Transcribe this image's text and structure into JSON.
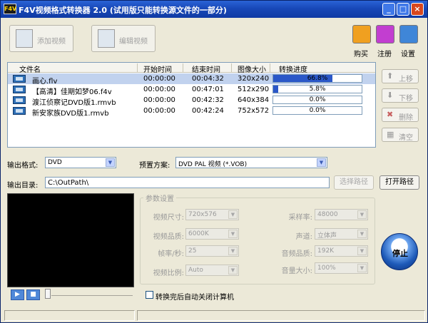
{
  "window": {
    "title": "F4V视频格式转换器 2.0 (试用版只能转换源文件的一部分)",
    "icon_text": "F4V",
    "controls": {
      "minimize": "_",
      "maximize": "□",
      "close": "×"
    }
  },
  "toolbar": {
    "add_video": "添加视频",
    "edit_video": "编辑视频",
    "buy": "购买",
    "register": "注册",
    "settings": "设置"
  },
  "file_list": {
    "headers": {
      "name": "文件名",
      "start": "开始时间",
      "end": "结束时间",
      "size": "图像大小",
      "progress": "转换进度"
    },
    "rows": [
      {
        "name": "画心.flv",
        "start": "00:00:00",
        "end": "00:04:32",
        "size": "320x240",
        "progress": 66.8,
        "progress_label": "66.8%",
        "selected": true
      },
      {
        "name": "【高清】佳期如梦06.f4v",
        "start": "00:00:00",
        "end": "00:47:01",
        "size": "512x290",
        "progress": 5.8,
        "progress_label": "5.8%",
        "selected": false
      },
      {
        "name": "渡江侦察记DVD版1.rmvb",
        "start": "00:00:00",
        "end": "00:42:32",
        "size": "640x384",
        "progress": 0,
        "progress_label": "0.0%",
        "selected": false
      },
      {
        "name": "新安家族DVD版1.rmvb",
        "start": "00:00:00",
        "end": "00:42:24",
        "size": "752x572",
        "progress": 0,
        "progress_label": "0.0%",
        "selected": false
      }
    ]
  },
  "side_buttons": {
    "move_up": {
      "label": "上移",
      "icon": "⬆"
    },
    "move_down": {
      "label": "下移",
      "icon": "⬇"
    },
    "delete": {
      "label": "删除",
      "icon": "✖"
    },
    "clear": {
      "label": "清空",
      "icon": "▦"
    }
  },
  "output": {
    "format_label": "输出格式:",
    "format_value": "DVD",
    "preset_label": "预置方案:",
    "preset_value": "DVD PAL 视频  (*.VOB)",
    "dir_label": "输出目录:",
    "dir_value": "C:\\OutPath\\",
    "choose_path": "选择路径",
    "open_path": "打开路径"
  },
  "params": {
    "group_title": "参数设置",
    "video_size": {
      "label": "视频尺寸:",
      "value": "720x576"
    },
    "video_quality": {
      "label": "视频品质:",
      "value": "6000K"
    },
    "fps": {
      "label": "帧率/秒:",
      "value": "25"
    },
    "aspect": {
      "label": "视频比例:",
      "value": "Auto"
    },
    "sample_rate": {
      "label": "采样率:",
      "value": "48000"
    },
    "channels": {
      "label": "声道:",
      "value": "立体声"
    },
    "audio_quality": {
      "label": "音频品质:",
      "value": "192K"
    },
    "volume": {
      "label": "音量大小:",
      "value": "100%"
    }
  },
  "shutdown_label": "转换完后自动关闭计算机",
  "stop_label": "停止",
  "player": {
    "play": "▶",
    "stop": "■"
  },
  "colors": {
    "progress": "#2a57c8",
    "titlebar": "#1848b8",
    "selection": "#c1d2ee"
  }
}
